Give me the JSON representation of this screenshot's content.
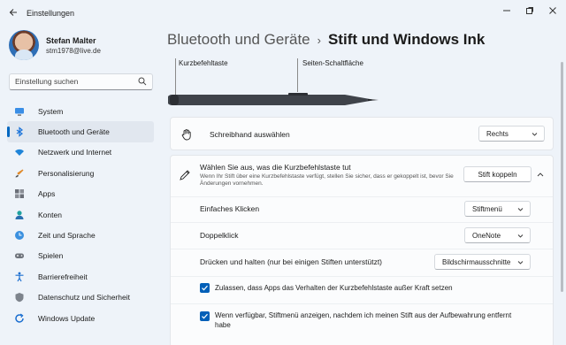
{
  "window": {
    "title": "Einstellungen"
  },
  "profile": {
    "name": "Stefan Malter",
    "email": "stm1978@live.de"
  },
  "search": {
    "placeholder": "Einstellung suchen"
  },
  "sidebar": {
    "items": [
      {
        "label": "System",
        "icon": "monitor-icon"
      },
      {
        "label": "Bluetooth und Geräte",
        "icon": "bluetooth-icon",
        "active": true
      },
      {
        "label": "Netzwerk und Internet",
        "icon": "wifi-icon"
      },
      {
        "label": "Personalisierung",
        "icon": "brush-icon"
      },
      {
        "label": "Apps",
        "icon": "apps-icon"
      },
      {
        "label": "Konten",
        "icon": "person-icon"
      },
      {
        "label": "Zeit und Sprache",
        "icon": "globe-clock-icon"
      },
      {
        "label": "Spielen",
        "icon": "gamepad-icon"
      },
      {
        "label": "Barrierefreiheit",
        "icon": "accessibility-icon"
      },
      {
        "label": "Datenschutz und Sicherheit",
        "icon": "shield-icon"
      },
      {
        "label": "Windows Update",
        "icon": "update-icon"
      }
    ]
  },
  "breadcrumb": {
    "parent": "Bluetooth und Geräte",
    "separator": "›",
    "current": "Stift und Windows Ink"
  },
  "pen": {
    "shortcut_label": "Kurzbefehltaste",
    "side_label": "Seiten-Schaltfläche"
  },
  "handwriting": {
    "title": "Schreibhand auswählen",
    "value": "Rechts"
  },
  "shortcut": {
    "title": "Wählen Sie aus, was die Kurzbefehlstaste tut",
    "description": "Wenn Ihr Stift über eine Kurzbefehlstaste verfügt, stellen Sie sicher, dass er gekoppelt ist, bevor Sie Änderungen vornehmen.",
    "pair_button": "Stift koppeln",
    "single_click": {
      "label": "Einfaches Klicken",
      "value": "Stiftmenü"
    },
    "double_click": {
      "label": "Doppelklick",
      "value": "OneNote"
    },
    "press_hold": {
      "label": "Drücken und halten (nur bei einigen Stiften unterstützt)",
      "value": "Bildschirmausschnitte"
    },
    "allow_apps": {
      "label": "Zulassen, dass Apps das Verhalten der Kurzbefehlstaste außer Kraft setzen",
      "checked": true
    },
    "show_menu": {
      "label": "Wenn verfügbar, Stiftmenü anzeigen, nachdem ich meinen Stift aus der Aufbewahrung entfernt habe",
      "checked": true
    }
  },
  "colors": {
    "accent": "#005fb8",
    "background": "#eef3f9",
    "card": "#fbfcfd"
  }
}
